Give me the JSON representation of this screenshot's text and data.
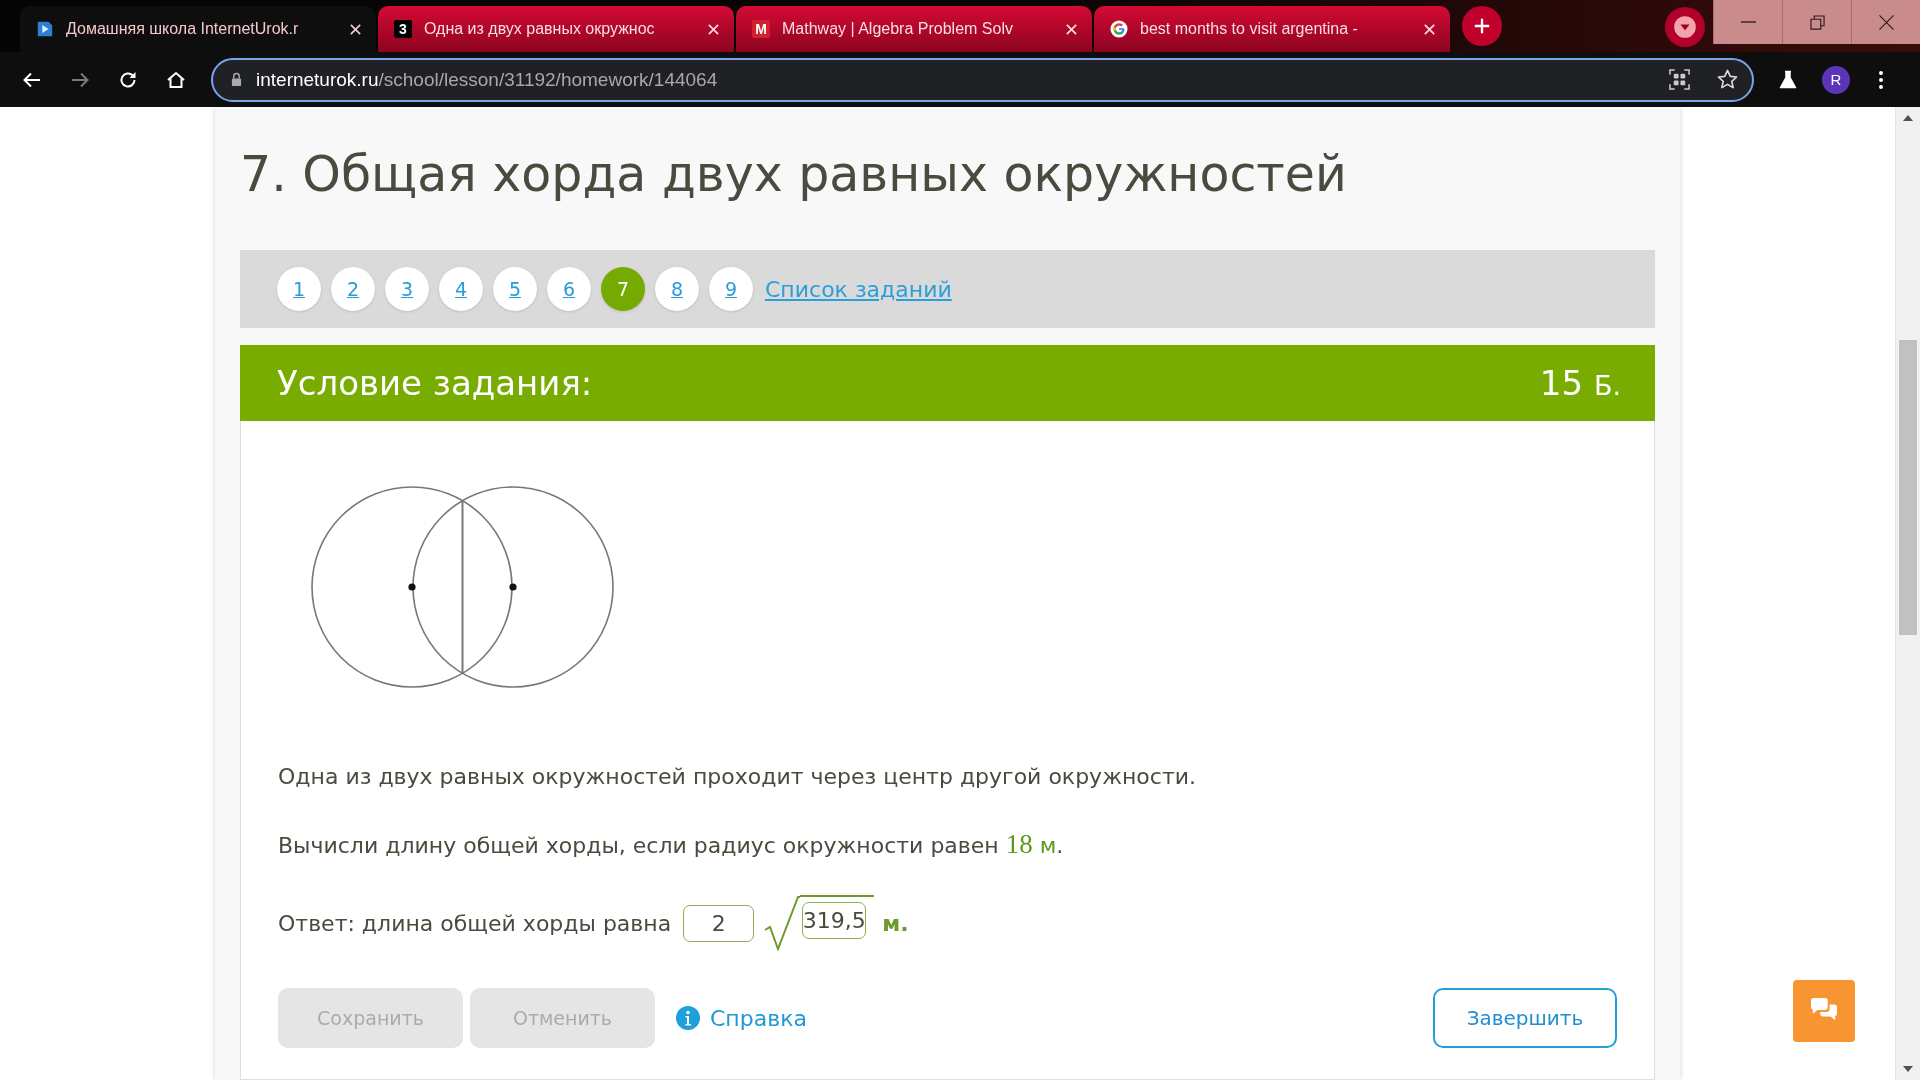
{
  "browser": {
    "tabs": [
      {
        "title": "Домашняя школа InternetUrok.r",
        "selected": true,
        "kind": "play"
      },
      {
        "title": "Одна из двух равных окружнос",
        "selected": false,
        "kind": "letter",
        "icon_text": "3",
        "color": "#000000"
      },
      {
        "title": "Mathway | Algebra Problem Solv",
        "selected": false,
        "kind": "letter",
        "icon_text": "M",
        "color": "#d3202f"
      },
      {
        "title": "best months to visit argentina -",
        "selected": false,
        "kind": "google"
      }
    ],
    "address_bar": {
      "host": "interneturok.ru",
      "path": "/school/lesson/31192/homework/144064",
      "focused": true
    },
    "profile": "R"
  },
  "page": {
    "heading": "7. Общая хорда двух равных окружностей",
    "task_nav": {
      "items": [
        {
          "label": "1",
          "selected": false
        },
        {
          "label": "2",
          "selected": false
        },
        {
          "label": "3",
          "selected": false
        },
        {
          "label": "4",
          "selected": false
        },
        {
          "label": "5",
          "selected": false
        },
        {
          "label": "6",
          "selected": false
        },
        {
          "label": "7",
          "selected": true
        },
        {
          "label": "8",
          "selected": false
        },
        {
          "label": "9",
          "selected": false
        }
      ],
      "list_link": "Список заданий"
    },
    "task": {
      "title": "Условие задания:",
      "points": "15",
      "points_unit": "Б.",
      "statement": "Одна из двух равных окружностей проходит через центр другой окружности.",
      "question": {
        "text": "Вычисли длину общей хорды, если радиус окружности равен",
        "number": "18",
        "unit": "м",
        "end": "."
      },
      "answer": {
        "label": "Ответ: длина общей хорды равна",
        "coefficient": "2",
        "radicand": "319,5",
        "unit": "м."
      }
    },
    "actions": [
      {
        "label": "Сохранить",
        "disabled": true
      },
      {
        "label": "Отменить",
        "disabled": true
      }
    ],
    "help_link": "Справка",
    "finish_button": "Завершить"
  }
}
